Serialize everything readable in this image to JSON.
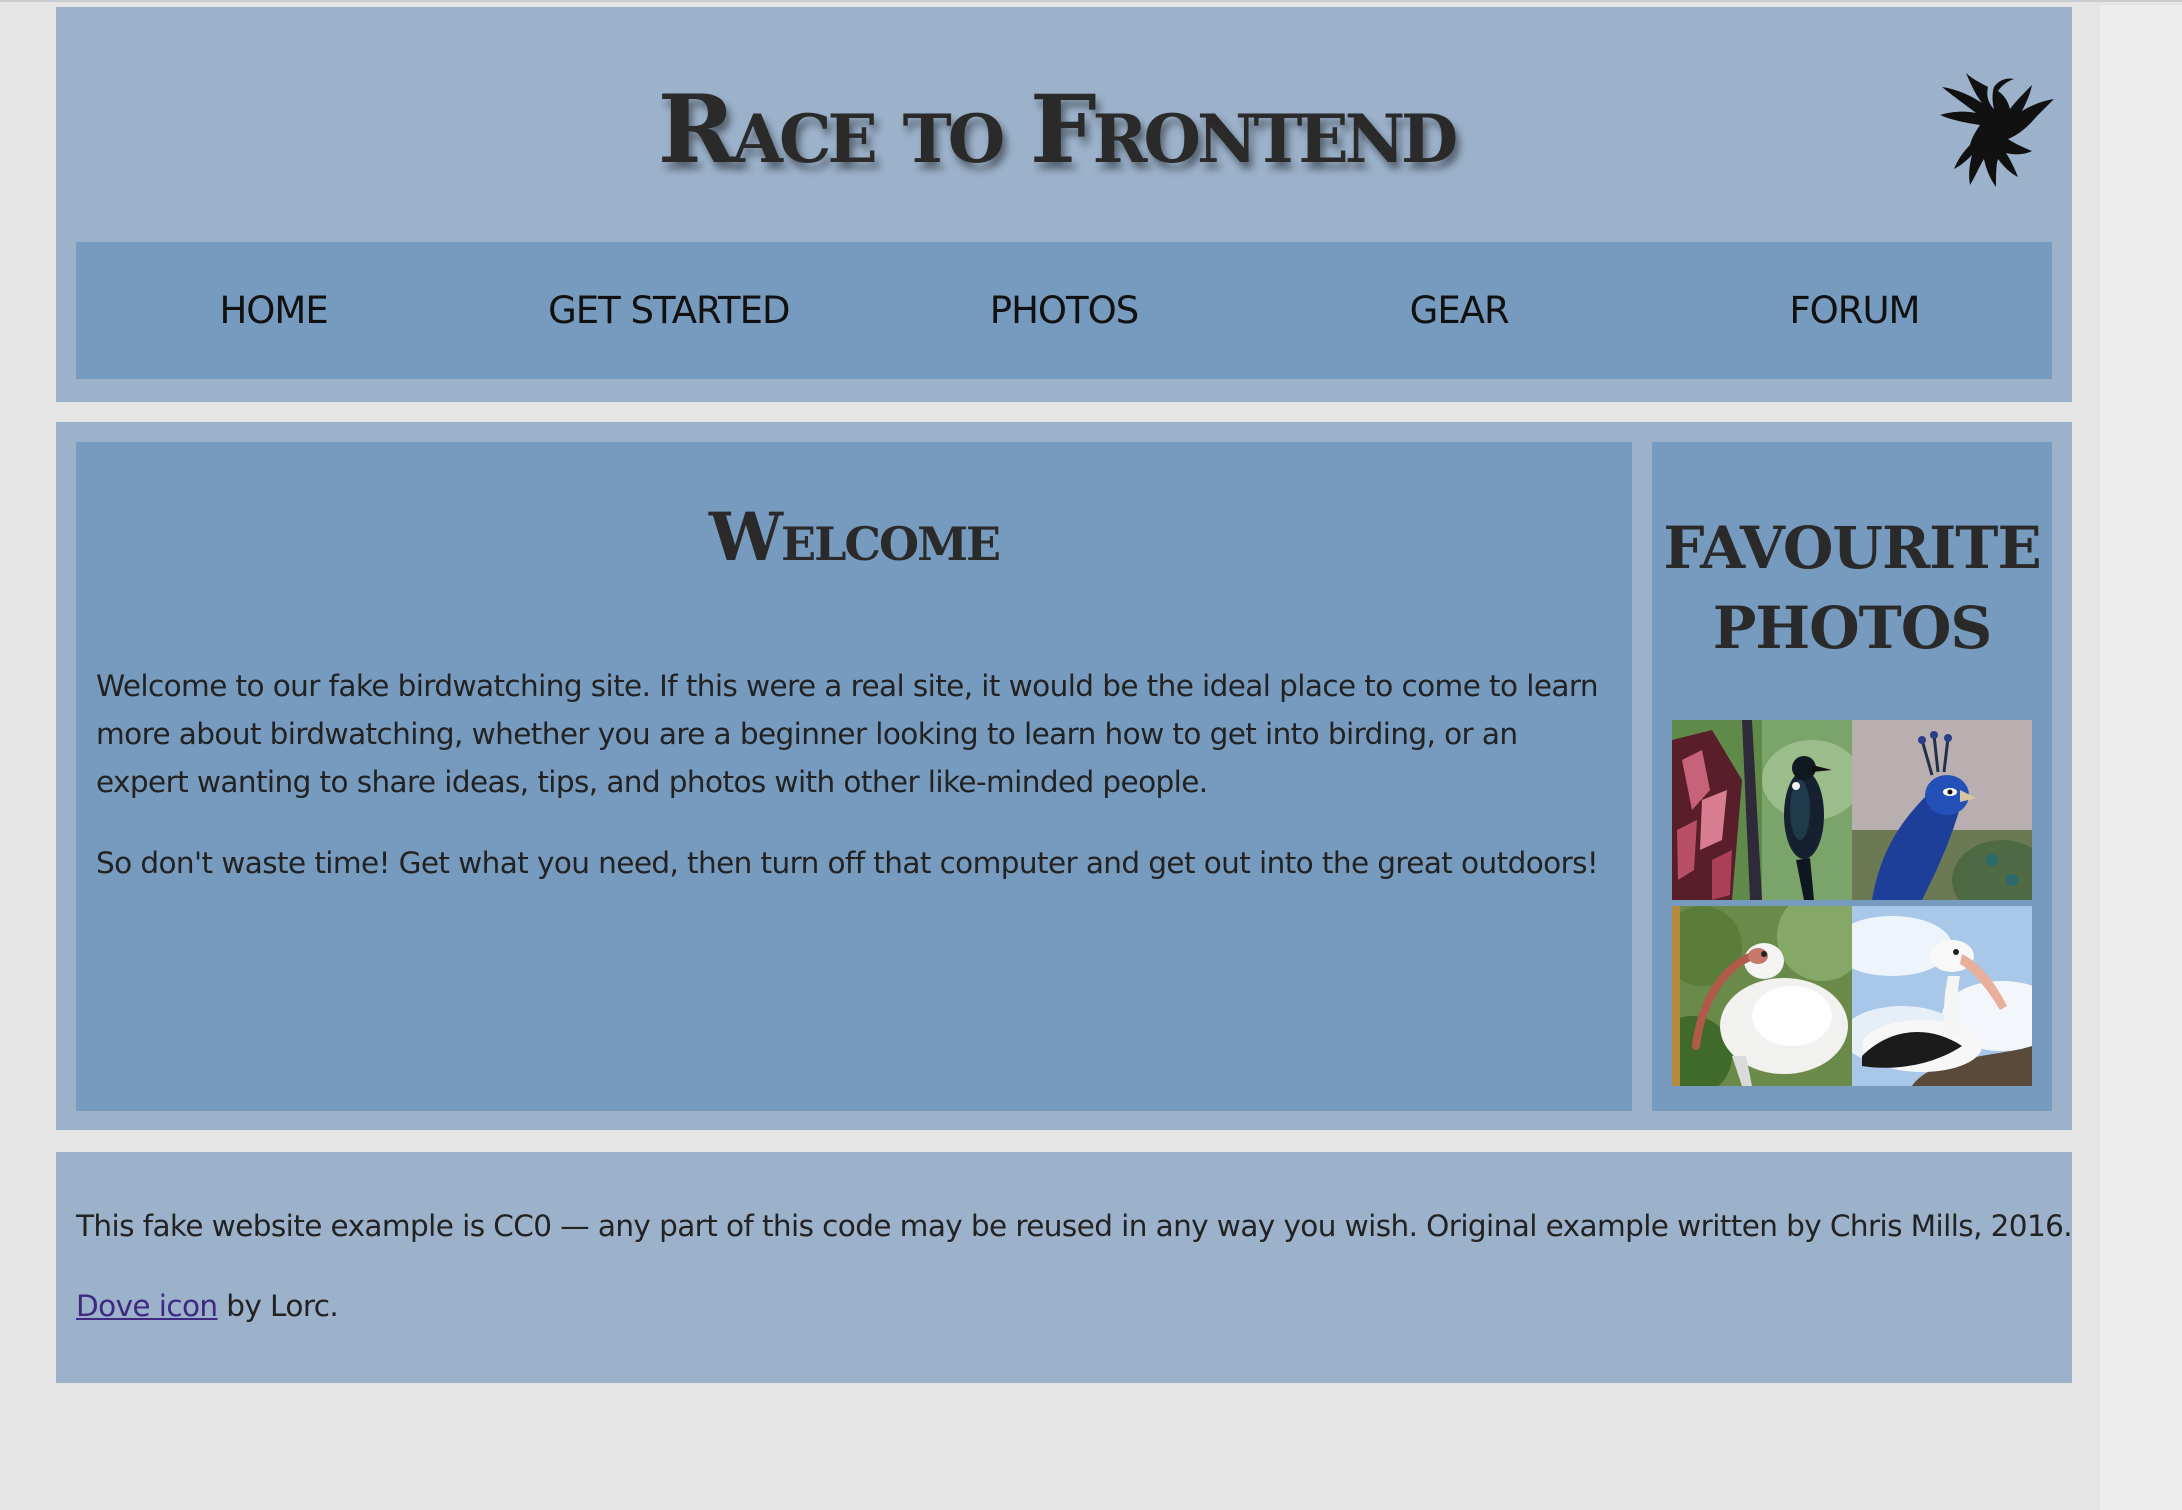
{
  "header": {
    "site_title": "Race to Frontend",
    "logo_icon": "dove-icon"
  },
  "nav": {
    "items": [
      {
        "label": "HOME"
      },
      {
        "label": "GET STARTED"
      },
      {
        "label": "PHOTOS"
      },
      {
        "label": "GEAR"
      },
      {
        "label": "FORUM"
      }
    ]
  },
  "main": {
    "heading": "Welcome",
    "paragraphs": [
      "Welcome to our fake birdwatching site. If this were a real site, it would be the ideal place to come to learn more about birdwatching, whether you are a beginner looking to learn how to get into birding, or an expert wanting to share ideas, tips, and photos with other like-minded people.",
      "So don't waste time! Get what you need, then turn off that computer and get out into the great outdoors!"
    ]
  },
  "sidebar": {
    "heading_line1": "FAVOURITE",
    "heading_line2": "PHOTOS",
    "photos": [
      {
        "subject": "tui-on-flax-flowers"
      },
      {
        "subject": "peacock"
      },
      {
        "subject": "white-ibis"
      },
      {
        "subject": "pelican"
      }
    ]
  },
  "footer": {
    "credit_text": "This fake website example is CC0 — any part of this code may be reused in any way you wish. Original example written by Chris Mills, 2016.",
    "icon_link_text": "Dove icon",
    "icon_credit_suffix": " by Lorc."
  },
  "colors": {
    "page_background": "#e5e5e5",
    "panel_light": "#9cb2cb",
    "panel_dark": "#779bbe",
    "text": "#222222",
    "link": "#3e2a80"
  }
}
